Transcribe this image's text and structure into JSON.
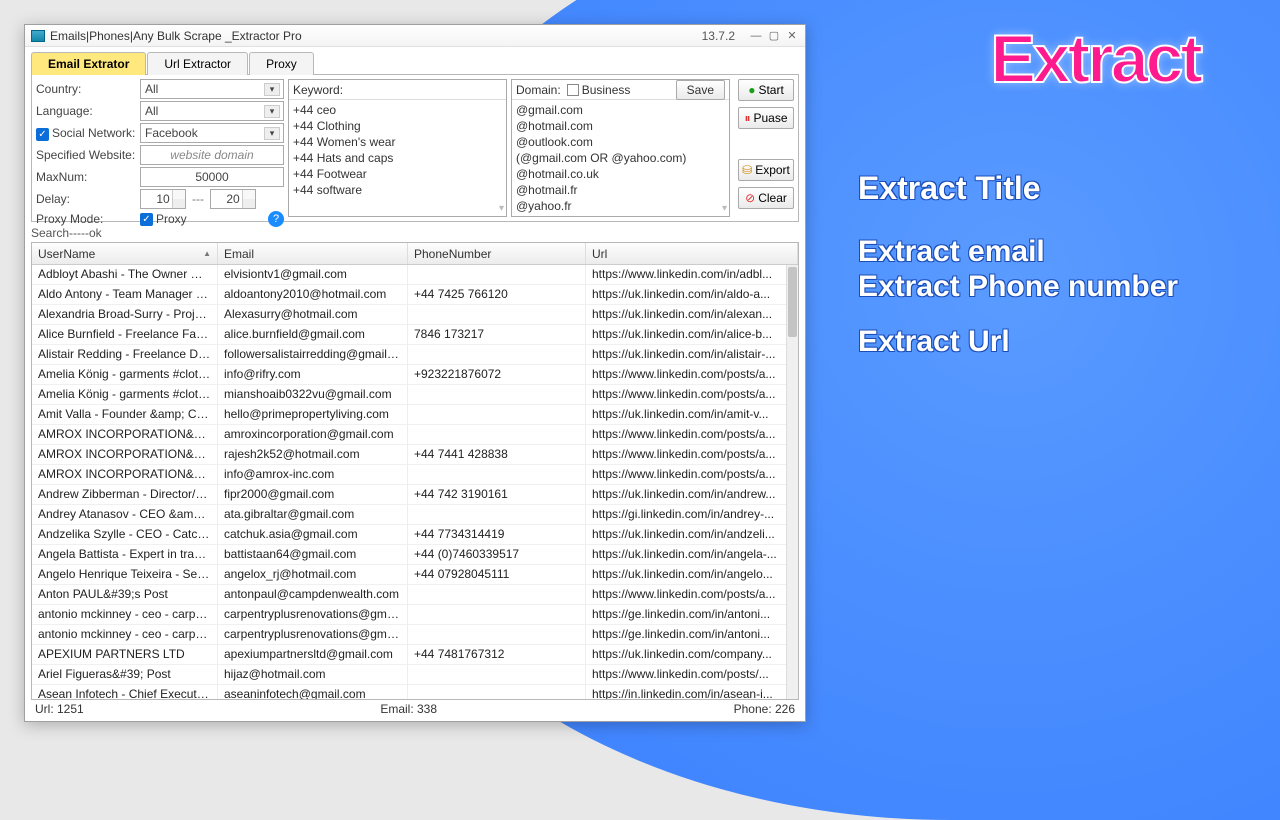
{
  "promo": {
    "title": "Extract",
    "s1": "Extract Title",
    "s2": "Extract email",
    "s3": "Extract Phone number",
    "s4": "Extract Url"
  },
  "win": {
    "title": "Emails|Phones|Any Bulk Scrape _Extractor Pro",
    "ver": "13.7.2"
  },
  "tabs": [
    "Email Extrator",
    "Url Extractor",
    "Proxy"
  ],
  "form": {
    "country": {
      "lbl": "Country:",
      "val": "All"
    },
    "language": {
      "lbl": "Language:",
      "val": "All"
    },
    "social": {
      "lbl": "Social Network:",
      "val": "Facebook"
    },
    "site": {
      "lbl": "Specified Website:",
      "ph": "website domain"
    },
    "max": {
      "lbl": "MaxNum:",
      "val": "50000"
    },
    "delay": {
      "lbl": "Delay:",
      "a": "10",
      "b": "20",
      "sep": "---"
    },
    "proxy": {
      "lbl": "Proxy Mode:",
      "chk": "Proxy"
    }
  },
  "kw": {
    "head": "Keyword:",
    "items": [
      "+44 ceo",
      "+44  Clothing",
      "+44 Women's wear",
      "+44  Hats and caps",
      "+44 Footwear",
      "+44 software"
    ]
  },
  "dom": {
    "head": "Domain:",
    "chk": "Business",
    "save": "Save",
    "items": [
      "@gmail.com",
      "@hotmail.com",
      "@outlook.com",
      "(@gmail.com OR @yahoo.com)",
      "@hotmail.co.uk",
      "@hotmail.fr",
      "@yahoo.fr"
    ]
  },
  "btns": {
    "start": "Start",
    "pause": "Puase",
    "export": "Export",
    "clear": "Clear"
  },
  "search": "Search-----ok",
  "cols": [
    "UserName",
    "Email",
    "PhoneNumber",
    "Url"
  ],
  "rows": [
    [
      "Adbloyt Abashi - The Owner CEO:...",
      "elvisiontv1@gmail.com",
      "",
      "https://www.linkedin.com/in/adbl..."
    ],
    [
      "Aldo Antony - Team Manager - Li...",
      "aldoantony2010@hotmail.com",
      "+44 7425 766120",
      "https://uk.linkedin.com/in/aldo-a..."
    ],
    [
      "Alexandria Broad-Surry - Project ...",
      "Alexasurry@hotmail.com",
      "",
      "https://uk.linkedin.com/in/alexan..."
    ],
    [
      "Alice Burnfield - Freelance Fashion...",
      "alice.burnfield@gmail.com",
      "7846 173217",
      "https://uk.linkedin.com/in/alice-b..."
    ],
    [
      "Alistair Redding - Freelance DoP a...",
      "followersalistairredding@gmail.co...",
      "",
      "https://uk.linkedin.com/in/alistair-..."
    ],
    [
      "Amelia König - garments #clothin...",
      "info@rifry.com",
      "+923221876072",
      "https://www.linkedin.com/posts/a..."
    ],
    [
      "Amelia König - garments #clothin...",
      "mianshoaib0322vu@gmail.com",
      "",
      "https://www.linkedin.com/posts/a..."
    ],
    [
      "Amit Valla - Founder &amp; CEO ...",
      "hello@primepropertyliving.com",
      "",
      "https://uk.linkedin.com/in/amit-v..."
    ],
    [
      "AMROX INCORPORATION&#39;s...",
      "amroxincorporation@gmail.com",
      "",
      "https://www.linkedin.com/posts/a..."
    ],
    [
      "AMROX INCORPORATION&#39;s...",
      "rajesh2k52@hotmail.com",
      "+44 7441 428838",
      "https://www.linkedin.com/posts/a..."
    ],
    [
      "AMROX INCORPORATION&#39;s...",
      "info@amrox-inc.com",
      "",
      "https://www.linkedin.com/posts/a..."
    ],
    [
      "Andrew Zibberman - Director/CE...",
      "fipr2000@gmail.com",
      "+44 742 3190161",
      "https://uk.linkedin.com/in/andrew..."
    ],
    [
      "Andrey Atanasov - CEO &amp;Fo...",
      "ata.gibraltar@gmail.com",
      "",
      "https://gi.linkedin.com/in/andrey-..."
    ],
    [
      "Andzelika Szylle - CEO - CatchAS",
      "catchuk.asia@gmail.com",
      "+44 7734314419",
      "https://uk.linkedin.com/in/andzeli..."
    ],
    [
      "Angela Battista - Expert in traditio...",
      "battistaan64@gmail.com",
      "+44 (0)7460339517",
      "https://uk.linkedin.com/in/angela-..."
    ],
    [
      "Angelo Henrique Teixeira - Senior ...",
      "angelox_rj@hotmail.com",
      "+44 07928045111",
      "https://uk.linkedin.com/in/angelo..."
    ],
    [
      "Anton PAUL&#39;s Post",
      "antonpaul@campdenwealth.com",
      "",
      "https://www.linkedin.com/posts/a..."
    ],
    [
      "antonio mckinney - ceo - carpentr...",
      "carpentryplusrenovations@gmail....",
      "",
      "https://ge.linkedin.com/in/antoni..."
    ],
    [
      "antonio mckinney - ceo - carpentr...",
      "carpentryplusrenovations@gmail....",
      "",
      "https://ge.linkedin.com/in/antoni..."
    ],
    [
      "APEXIUM PARTNERS LTD",
      "apexiumpartnersltd@gmail.com",
      "+44 7481767312",
      "https://uk.linkedin.com/company..."
    ],
    [
      "Ariel Figueras&#39; Post",
      "hijaz@hotmail.com",
      "",
      "https://www.linkedin.com/posts/..."
    ],
    [
      "Asean Infotech - Chief Executive ...",
      "aseaninfotech@gmail.com",
      "",
      "https://in.linkedin.com/in/asean-i..."
    ]
  ],
  "status": {
    "url": "Url:  1251",
    "email": "Email:  338",
    "phone": "Phone:  226"
  }
}
